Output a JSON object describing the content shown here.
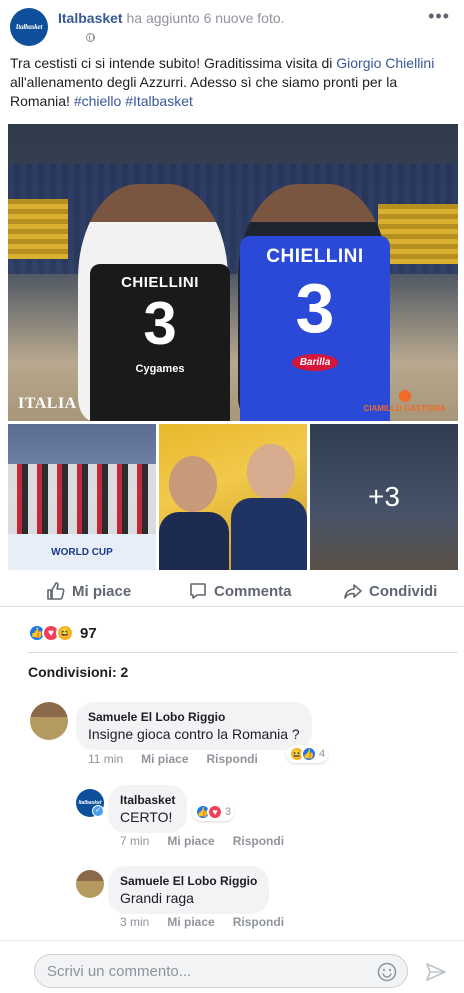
{
  "header": {
    "page_name": "Italbasket",
    "action_text": "ha aggiunto",
    "photo_link": "6 nuove foto",
    "period": ".",
    "avatar_logo": "Italbasket",
    "privacy_icon": "globe-icon",
    "menu_glyph": "•••"
  },
  "post": {
    "text_1": "Tra cestisti ci si intende subito! Graditissima visita di ",
    "mention": "Giorgio Chiellini",
    "text_2": " all'allenamento degli Azzurri. Adesso sì che siamo pronti per la Romania! ",
    "hashtag_1": "#chiello",
    "hashtag_2": "#Italbasket"
  },
  "photos": {
    "jersey_black_name": "CHIELLINI",
    "jersey_black_number": "3",
    "jersey_black_sponsor": "Cygames",
    "jersey_blue_name": "CHIELLINI",
    "jersey_blue_number": "3",
    "jersey_blue_sponsor": "Barilla",
    "watermark_left": "ITALIA",
    "watermark_right": "CIAMILLO CASTORIA",
    "small_1_banner": "WORLD CUP",
    "more_count": "+3"
  },
  "actions": {
    "like": "Mi piace",
    "comment": "Commenta",
    "share": "Condividi"
  },
  "reactions": {
    "count": "97",
    "types": [
      "like",
      "love",
      "haha"
    ]
  },
  "shares": "Condivisioni: 2",
  "comments": [
    {
      "author": "Samuele El Lobo Riggio",
      "text": "Insigne gioca contro la Romania ?",
      "time": "11 min",
      "like": "Mi piace",
      "reply": "Rispondi",
      "reaction_count": "4"
    },
    {
      "author": "Italbasket",
      "text": "CERTO!",
      "time": "7 min",
      "like": "Mi piace",
      "reply": "Rispondi",
      "reaction_count": "3"
    },
    {
      "author": "Samuele El Lobo Riggio",
      "text": "Grandi raga",
      "time": "3 min",
      "like": "Mi piace",
      "reply": "Rispondi"
    }
  ],
  "composer": {
    "placeholder": "Scrivi un commento..."
  },
  "colors": {
    "link_blue": "#385898",
    "meta_gray": "#90949c",
    "like_blue": "#1877f2",
    "love_red": "#f33e58",
    "haha_yellow": "#f7b125",
    "bubble_gray": "#f2f3f5"
  }
}
